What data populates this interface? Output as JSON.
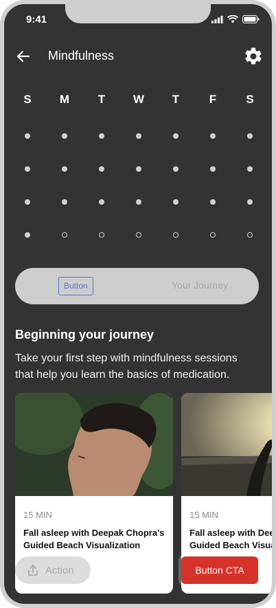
{
  "status": {
    "time": "9:41"
  },
  "header": {
    "title": "Mindfulness",
    "back_icon": "arrow-left-icon",
    "settings_icon": "gear-icon"
  },
  "calendar": {
    "days": [
      "S",
      "M",
      "T",
      "W",
      "T",
      "F",
      "S"
    ],
    "weeks": [
      [
        true,
        true,
        true,
        true,
        true,
        true,
        true
      ],
      [
        true,
        true,
        true,
        true,
        true,
        true,
        true
      ],
      [
        true,
        true,
        true,
        true,
        true,
        true,
        true
      ],
      [
        true,
        false,
        false,
        false,
        false,
        false,
        false
      ]
    ]
  },
  "segment": {
    "button_label": "Button",
    "tab_label": "Your Journey"
  },
  "section": {
    "title": "Beginning your journey",
    "description": "Take your first step with mindfulness sessions that help you learn the basics of medication."
  },
  "cards": [
    {
      "duration": "15 MIN",
      "title": "Fall asleep with Deepak Chopra’s Guided Beach Visualization"
    },
    {
      "duration": "15 MIN",
      "title": "Fall asleep with Deepak Chopra’s Guided Beach Visualization"
    }
  ],
  "actions": {
    "action_label": "Action",
    "cta_label": "Button CTA"
  },
  "colors": {
    "background": "#333333",
    "cta": "#d7322a",
    "outline_button": "#5b73c8"
  }
}
